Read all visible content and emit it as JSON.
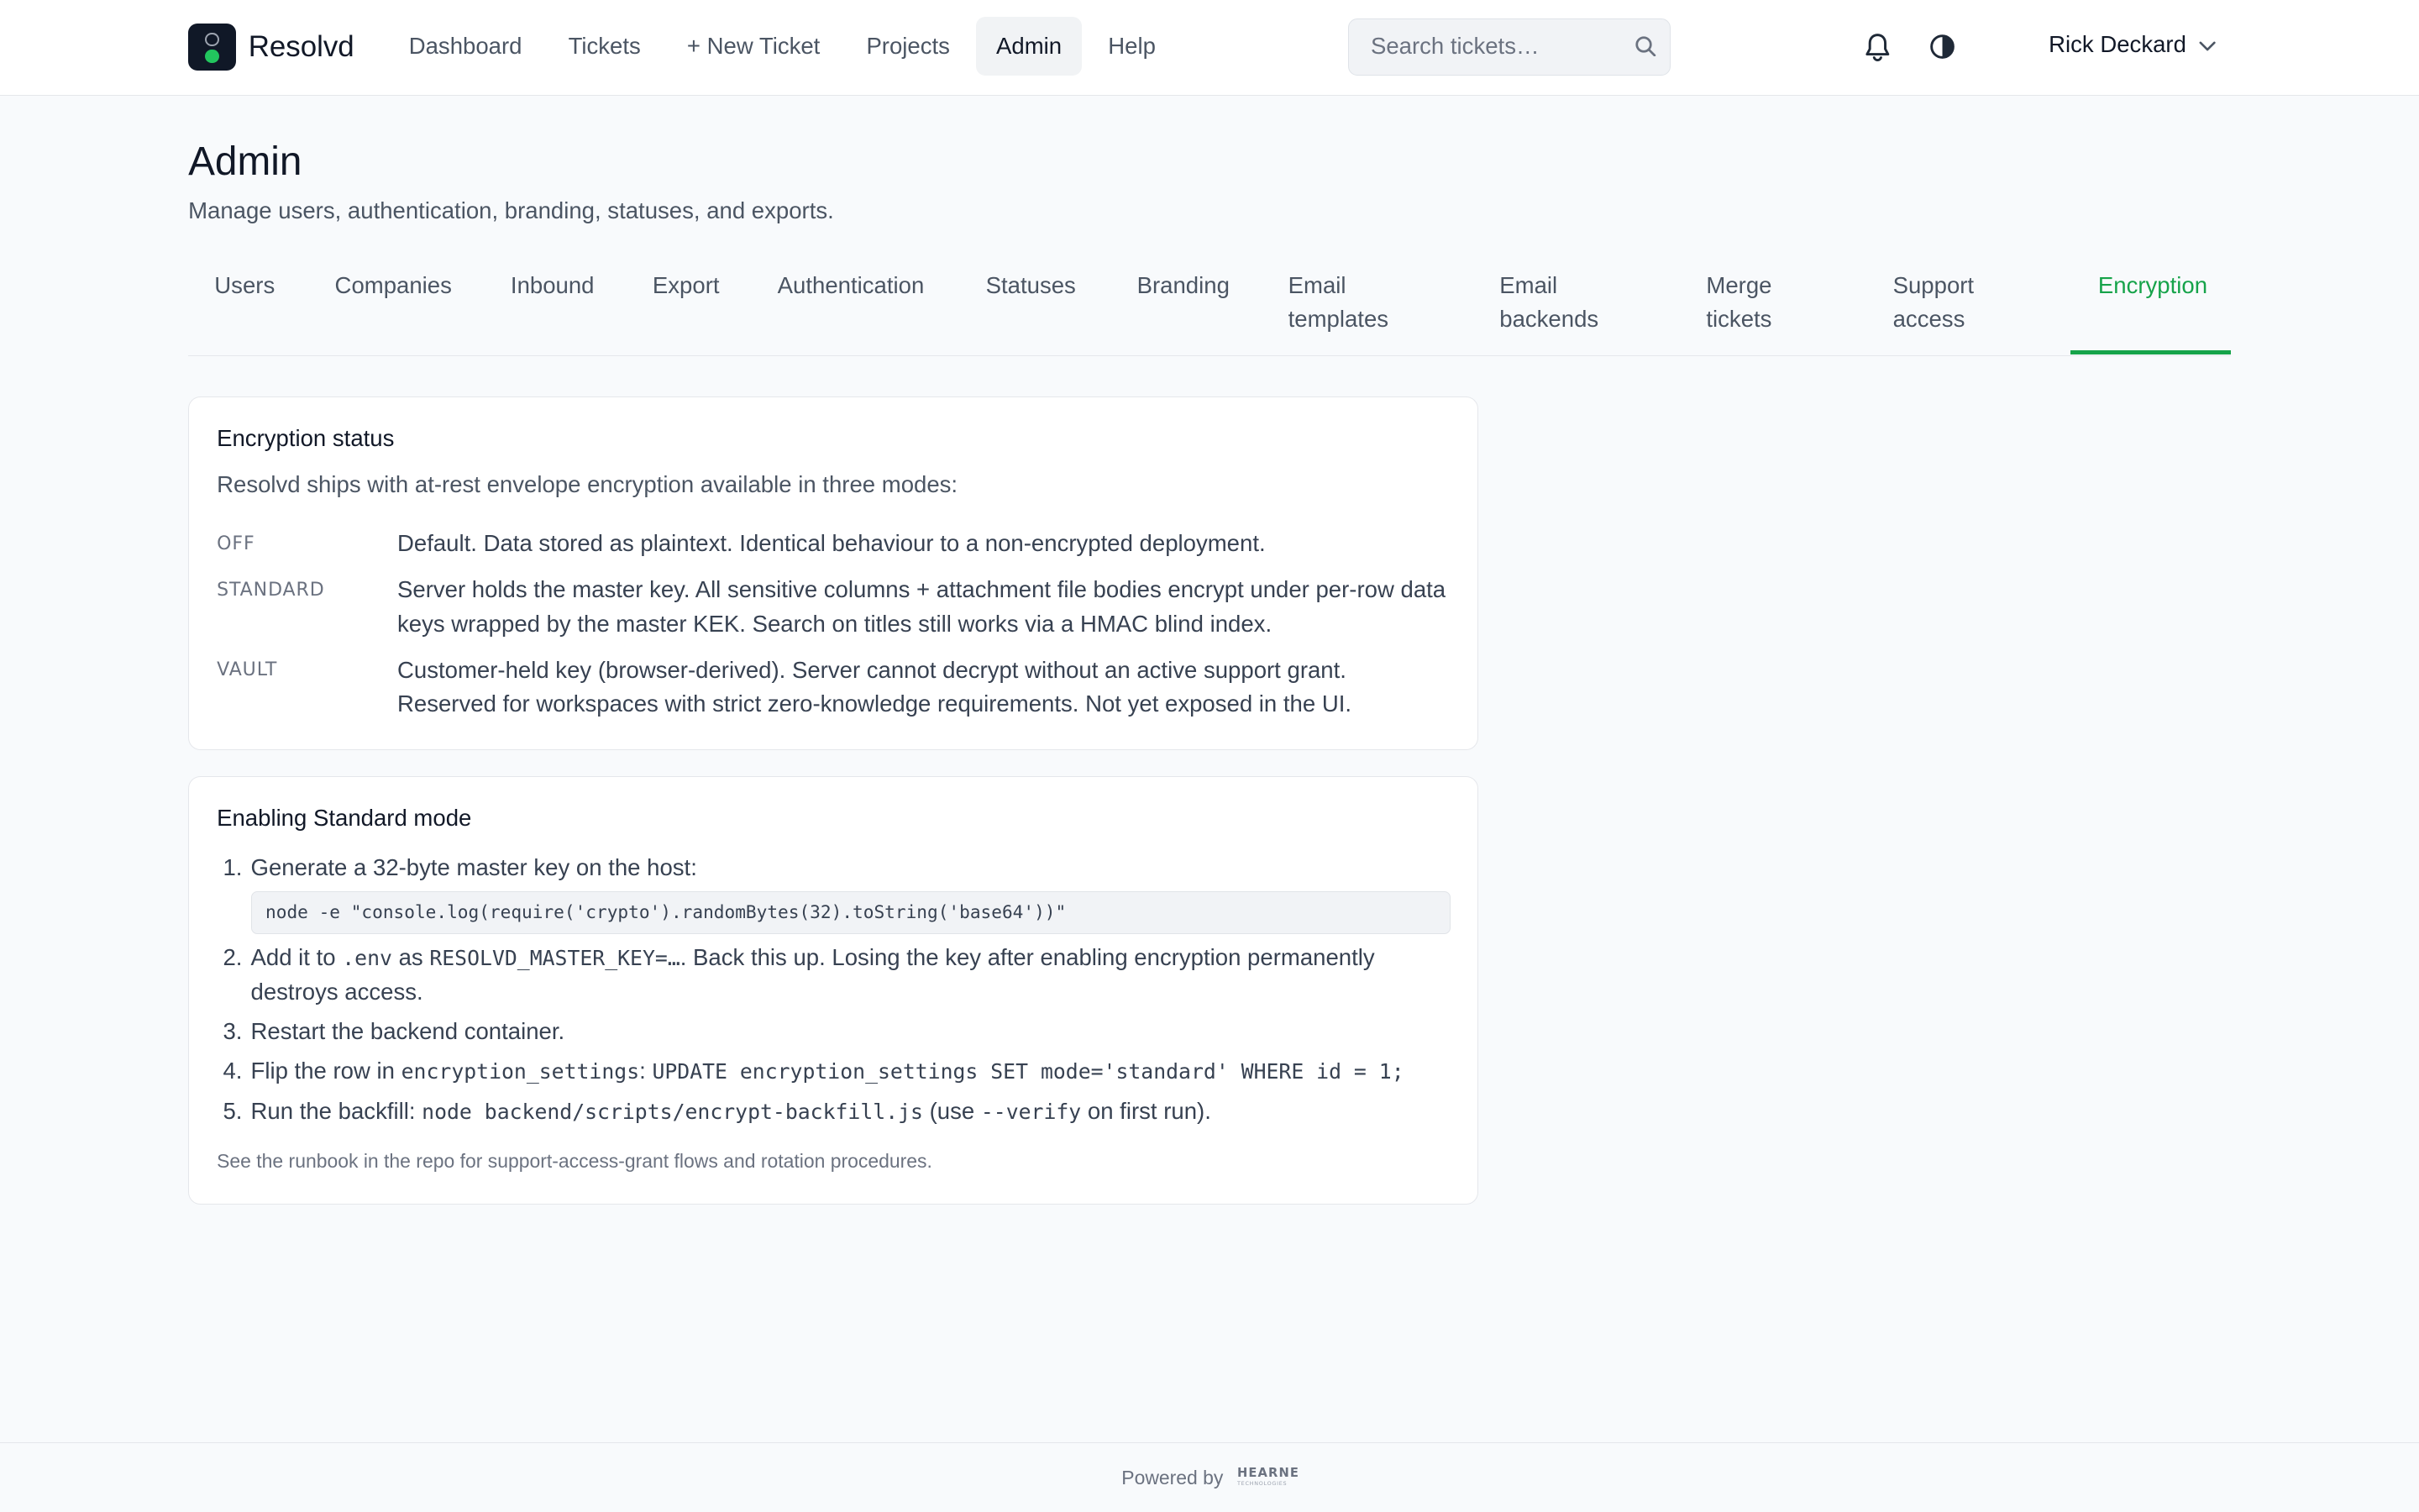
{
  "app": {
    "name": "Resolvd",
    "nav": [
      "Dashboard",
      "Tickets",
      "+ New Ticket",
      "Projects",
      "Admin",
      "Help"
    ],
    "active_nav": "Admin",
    "search_placeholder": "Search tickets…",
    "user_name": "Rick Deckard"
  },
  "page": {
    "title": "Admin",
    "subtitle": "Manage users, authentication, branding, statuses, and exports."
  },
  "tabs": [
    {
      "line1": "Users",
      "line2": ""
    },
    {
      "line1": "Companies",
      "line2": ""
    },
    {
      "line1": "Inbound",
      "line2": ""
    },
    {
      "line1": "Export",
      "line2": ""
    },
    {
      "line1": "Authentication",
      "line2": ""
    },
    {
      "line1": "Statuses",
      "line2": ""
    },
    {
      "line1": "Branding",
      "line2": ""
    },
    {
      "line1": "Email",
      "line2": "templates"
    },
    {
      "line1": "Email",
      "line2": "backends"
    },
    {
      "line1": "Merge",
      "line2": "tickets"
    },
    {
      "line1": "Support",
      "line2": "access"
    },
    {
      "line1": "Encryption",
      "line2": ""
    }
  ],
  "active_tab": "Encryption",
  "encryption_status": {
    "title": "Encryption status",
    "intro": "Resolvd ships with at-rest envelope encryption available in three modes:",
    "modes": [
      {
        "key": "OFF",
        "desc": "Default. Data stored as plaintext. Identical behaviour to a non-encrypted deployment."
      },
      {
        "key": "STANDARD",
        "desc": "Server holds the master key. All sensitive columns + attachment file bodies encrypt under per-row data keys wrapped by the master KEK. Search on titles still works via a HMAC blind index."
      },
      {
        "key": "VAULT",
        "desc": "Customer-held key (browser-derived). Server cannot decrypt without an active support grant. Reserved for workspaces with strict zero-knowledge requirements. Not yet exposed in the UI."
      }
    ]
  },
  "enabling": {
    "title": "Enabling Standard mode",
    "step1": "Generate a 32-byte master key on the host:",
    "step1_code": "node -e \"console.log(require('crypto').randomBytes(32).toString('base64'))\"",
    "step2_a": "Add it to ",
    "step2_code1": ".env",
    "step2_b": " as ",
    "step2_code2": "RESOLVD_MASTER_KEY=…",
    "step2_c": ". Back this up. Losing the key after enabling encryption permanently destroys access.",
    "step3": "Restart the backend container.",
    "step4_a": "Flip the row in ",
    "step4_code1": "encryption_settings",
    "step4_b": ": ",
    "step4_code2": "UPDATE encryption_settings SET mode='standard' WHERE id = 1;",
    "step5_a": "Run the backfill: ",
    "step5_code1": "node backend/scripts/encrypt-backfill.js",
    "step5_b": " (use ",
    "step5_code2": "--verify",
    "step5_c": " on first run).",
    "note": "See the runbook in the repo for support-access-grant flows and rotation procedures."
  },
  "footer": {
    "powered_by": "Powered by",
    "brand": "HEARNE",
    "brand_tag": "TECHNOLOGIES"
  }
}
